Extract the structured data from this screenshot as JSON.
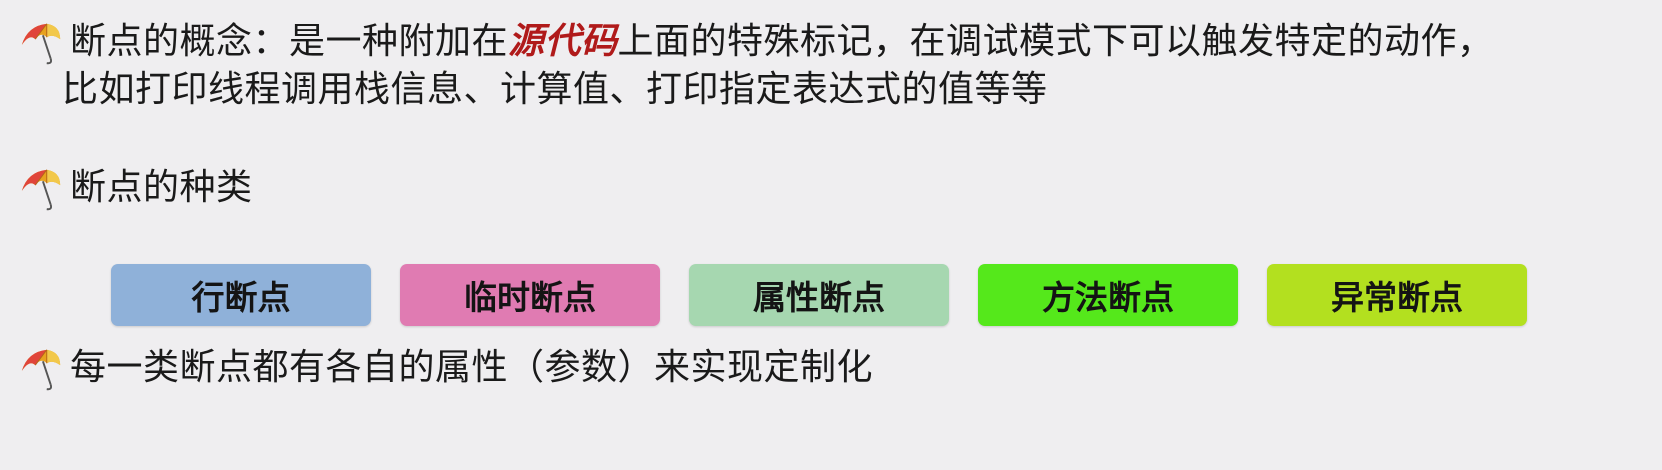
{
  "bullets": [
    {
      "before": "断点的概念：是一种附加在",
      "highlight": "源代码",
      "after": "上面的特殊标记，在调试模式下可以触发特定的动作，",
      "line2": "比如打印线程调用栈信息、计算值、打印指定表达式的值等等",
      "icon": "umbrella-icon"
    },
    {
      "text": "断点的种类",
      "icon": "umbrella-icon"
    },
    {
      "text": "每一类断点都有各自的属性（参数）来实现定制化",
      "icon": "umbrella-icon"
    }
  ],
  "breakpoint_types": [
    {
      "label": "行断点",
      "color": "#8fb1d9"
    },
    {
      "label": "临时断点",
      "color": "#e07bb2"
    },
    {
      "label": "属性断点",
      "color": "#a6d7b0"
    },
    {
      "label": "方法断点",
      "color": "#55e81b"
    },
    {
      "label": "异常断点",
      "color": "#b3e01f"
    }
  ],
  "colors": {
    "background": "#efeef0",
    "highlight": "#b01a1a"
  }
}
